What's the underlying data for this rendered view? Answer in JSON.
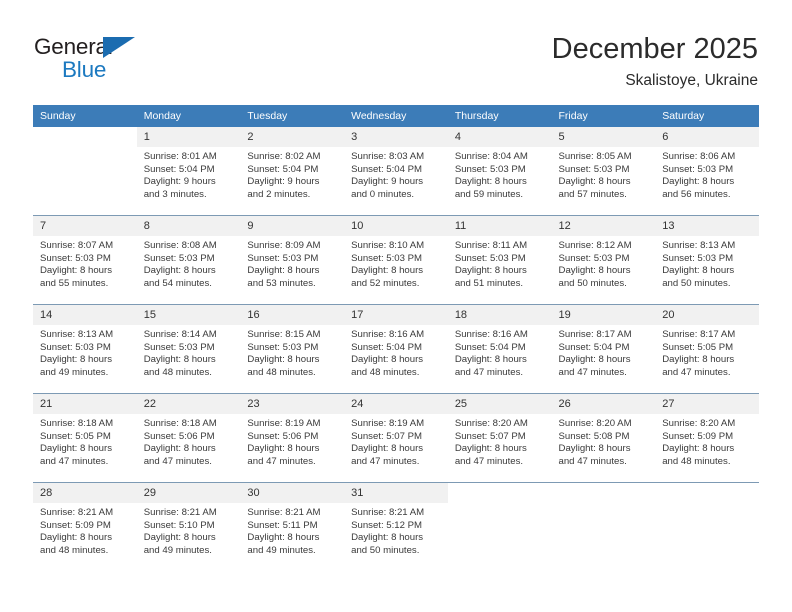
{
  "brand": {
    "name_top": "General",
    "name_bottom": "Blue",
    "accent_color": "#1b6cb0",
    "text_color": "#231f20"
  },
  "header": {
    "title": "December 2025",
    "subtitle": "Skalistoye, Ukraine"
  },
  "theme": {
    "header_bar_color": "#3c7cb8",
    "daynum_bg_color": "#f1f1f1",
    "row_divider_color": "#7d9ab4"
  },
  "weekday_headers": [
    "Sunday",
    "Monday",
    "Tuesday",
    "Wednesday",
    "Thursday",
    "Friday",
    "Saturday"
  ],
  "weeks": [
    [
      {
        "day": "",
        "sunrise": "",
        "sunset": "",
        "daylight_line1": "",
        "daylight_line2": "",
        "blank": true
      },
      {
        "day": "1",
        "sunrise": "Sunrise: 8:01 AM",
        "sunset": "Sunset: 5:04 PM",
        "daylight_line1": "Daylight: 9 hours",
        "daylight_line2": "and 3 minutes.",
        "blank": false
      },
      {
        "day": "2",
        "sunrise": "Sunrise: 8:02 AM",
        "sunset": "Sunset: 5:04 PM",
        "daylight_line1": "Daylight: 9 hours",
        "daylight_line2": "and 2 minutes.",
        "blank": false
      },
      {
        "day": "3",
        "sunrise": "Sunrise: 8:03 AM",
        "sunset": "Sunset: 5:04 PM",
        "daylight_line1": "Daylight: 9 hours",
        "daylight_line2": "and 0 minutes.",
        "blank": false
      },
      {
        "day": "4",
        "sunrise": "Sunrise: 8:04 AM",
        "sunset": "Sunset: 5:03 PM",
        "daylight_line1": "Daylight: 8 hours",
        "daylight_line2": "and 59 minutes.",
        "blank": false
      },
      {
        "day": "5",
        "sunrise": "Sunrise: 8:05 AM",
        "sunset": "Sunset: 5:03 PM",
        "daylight_line1": "Daylight: 8 hours",
        "daylight_line2": "and 57 minutes.",
        "blank": false
      },
      {
        "day": "6",
        "sunrise": "Sunrise: 8:06 AM",
        "sunset": "Sunset: 5:03 PM",
        "daylight_line1": "Daylight: 8 hours",
        "daylight_line2": "and 56 minutes.",
        "blank": false
      }
    ],
    [
      {
        "day": "7",
        "sunrise": "Sunrise: 8:07 AM",
        "sunset": "Sunset: 5:03 PM",
        "daylight_line1": "Daylight: 8 hours",
        "daylight_line2": "and 55 minutes.",
        "blank": false
      },
      {
        "day": "8",
        "sunrise": "Sunrise: 8:08 AM",
        "sunset": "Sunset: 5:03 PM",
        "daylight_line1": "Daylight: 8 hours",
        "daylight_line2": "and 54 minutes.",
        "blank": false
      },
      {
        "day": "9",
        "sunrise": "Sunrise: 8:09 AM",
        "sunset": "Sunset: 5:03 PM",
        "daylight_line1": "Daylight: 8 hours",
        "daylight_line2": "and 53 minutes.",
        "blank": false
      },
      {
        "day": "10",
        "sunrise": "Sunrise: 8:10 AM",
        "sunset": "Sunset: 5:03 PM",
        "daylight_line1": "Daylight: 8 hours",
        "daylight_line2": "and 52 minutes.",
        "blank": false
      },
      {
        "day": "11",
        "sunrise": "Sunrise: 8:11 AM",
        "sunset": "Sunset: 5:03 PM",
        "daylight_line1": "Daylight: 8 hours",
        "daylight_line2": "and 51 minutes.",
        "blank": false
      },
      {
        "day": "12",
        "sunrise": "Sunrise: 8:12 AM",
        "sunset": "Sunset: 5:03 PM",
        "daylight_line1": "Daylight: 8 hours",
        "daylight_line2": "and 50 minutes.",
        "blank": false
      },
      {
        "day": "13",
        "sunrise": "Sunrise: 8:13 AM",
        "sunset": "Sunset: 5:03 PM",
        "daylight_line1": "Daylight: 8 hours",
        "daylight_line2": "and 50 minutes.",
        "blank": false
      }
    ],
    [
      {
        "day": "14",
        "sunrise": "Sunrise: 8:13 AM",
        "sunset": "Sunset: 5:03 PM",
        "daylight_line1": "Daylight: 8 hours",
        "daylight_line2": "and 49 minutes.",
        "blank": false
      },
      {
        "day": "15",
        "sunrise": "Sunrise: 8:14 AM",
        "sunset": "Sunset: 5:03 PM",
        "daylight_line1": "Daylight: 8 hours",
        "daylight_line2": "and 48 minutes.",
        "blank": false
      },
      {
        "day": "16",
        "sunrise": "Sunrise: 8:15 AM",
        "sunset": "Sunset: 5:03 PM",
        "daylight_line1": "Daylight: 8 hours",
        "daylight_line2": "and 48 minutes.",
        "blank": false
      },
      {
        "day": "17",
        "sunrise": "Sunrise: 8:16 AM",
        "sunset": "Sunset: 5:04 PM",
        "daylight_line1": "Daylight: 8 hours",
        "daylight_line2": "and 48 minutes.",
        "blank": false
      },
      {
        "day": "18",
        "sunrise": "Sunrise: 8:16 AM",
        "sunset": "Sunset: 5:04 PM",
        "daylight_line1": "Daylight: 8 hours",
        "daylight_line2": "and 47 minutes.",
        "blank": false
      },
      {
        "day": "19",
        "sunrise": "Sunrise: 8:17 AM",
        "sunset": "Sunset: 5:04 PM",
        "daylight_line1": "Daylight: 8 hours",
        "daylight_line2": "and 47 minutes.",
        "blank": false
      },
      {
        "day": "20",
        "sunrise": "Sunrise: 8:17 AM",
        "sunset": "Sunset: 5:05 PM",
        "daylight_line1": "Daylight: 8 hours",
        "daylight_line2": "and 47 minutes.",
        "blank": false
      }
    ],
    [
      {
        "day": "21",
        "sunrise": "Sunrise: 8:18 AM",
        "sunset": "Sunset: 5:05 PM",
        "daylight_line1": "Daylight: 8 hours",
        "daylight_line2": "and 47 minutes.",
        "blank": false
      },
      {
        "day": "22",
        "sunrise": "Sunrise: 8:18 AM",
        "sunset": "Sunset: 5:06 PM",
        "daylight_line1": "Daylight: 8 hours",
        "daylight_line2": "and 47 minutes.",
        "blank": false
      },
      {
        "day": "23",
        "sunrise": "Sunrise: 8:19 AM",
        "sunset": "Sunset: 5:06 PM",
        "daylight_line1": "Daylight: 8 hours",
        "daylight_line2": "and 47 minutes.",
        "blank": false
      },
      {
        "day": "24",
        "sunrise": "Sunrise: 8:19 AM",
        "sunset": "Sunset: 5:07 PM",
        "daylight_line1": "Daylight: 8 hours",
        "daylight_line2": "and 47 minutes.",
        "blank": false
      },
      {
        "day": "25",
        "sunrise": "Sunrise: 8:20 AM",
        "sunset": "Sunset: 5:07 PM",
        "daylight_line1": "Daylight: 8 hours",
        "daylight_line2": "and 47 minutes.",
        "blank": false
      },
      {
        "day": "26",
        "sunrise": "Sunrise: 8:20 AM",
        "sunset": "Sunset: 5:08 PM",
        "daylight_line1": "Daylight: 8 hours",
        "daylight_line2": "and 47 minutes.",
        "blank": false
      },
      {
        "day": "27",
        "sunrise": "Sunrise: 8:20 AM",
        "sunset": "Sunset: 5:09 PM",
        "daylight_line1": "Daylight: 8 hours",
        "daylight_line2": "and 48 minutes.",
        "blank": false
      }
    ],
    [
      {
        "day": "28",
        "sunrise": "Sunrise: 8:21 AM",
        "sunset": "Sunset: 5:09 PM",
        "daylight_line1": "Daylight: 8 hours",
        "daylight_line2": "and 48 minutes.",
        "blank": false
      },
      {
        "day": "29",
        "sunrise": "Sunrise: 8:21 AM",
        "sunset": "Sunset: 5:10 PM",
        "daylight_line1": "Daylight: 8 hours",
        "daylight_line2": "and 49 minutes.",
        "blank": false
      },
      {
        "day": "30",
        "sunrise": "Sunrise: 8:21 AM",
        "sunset": "Sunset: 5:11 PM",
        "daylight_line1": "Daylight: 8 hours",
        "daylight_line2": "and 49 minutes.",
        "blank": false
      },
      {
        "day": "31",
        "sunrise": "Sunrise: 8:21 AM",
        "sunset": "Sunset: 5:12 PM",
        "daylight_line1": "Daylight: 8 hours",
        "daylight_line2": "and 50 minutes.",
        "blank": false
      },
      {
        "day": "",
        "sunrise": "",
        "sunset": "",
        "daylight_line1": "",
        "daylight_line2": "",
        "blank": true
      },
      {
        "day": "",
        "sunrise": "",
        "sunset": "",
        "daylight_line1": "",
        "daylight_line2": "",
        "blank": true
      },
      {
        "day": "",
        "sunrise": "",
        "sunset": "",
        "daylight_line1": "",
        "daylight_line2": "",
        "blank": true
      }
    ]
  ]
}
